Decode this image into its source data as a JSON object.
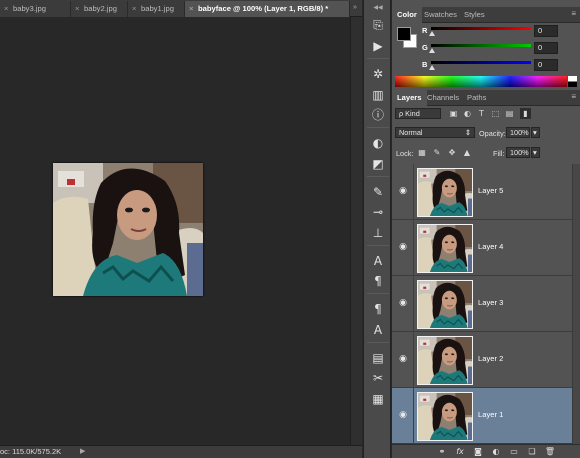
{
  "document_tabs": [
    {
      "close": "×",
      "label": "baby3.jpg",
      "active": false
    },
    {
      "close": "×",
      "label": "baby2.jpg",
      "active": false
    },
    {
      "close": "×",
      "label": "baby1.jpg",
      "active": false
    },
    {
      "close": "×",
      "label": "babyface @ 100% (Layer 1, RGB/8) *",
      "active": true
    }
  ],
  "tab_collapse_glyph": "»",
  "status": {
    "doc_size": "oc: 115.0K/575.2K",
    "arrow": "▶"
  },
  "dock": {
    "collapse_glyph": "◀◀",
    "icons": [
      "history-icon",
      "actions-icon",
      "navigator-icon",
      "histogram-icon",
      "info-icon",
      "adjustments-icon",
      "styles-icon",
      "brush-icon",
      "brush-presets-icon",
      "clone-source-icon",
      "character-icon",
      "paragraph-icon",
      "character-styles-icon",
      "paragraph-styles-icon",
      "layer-comps-icon",
      "tool-presets-icon",
      "notes-icon"
    ]
  },
  "color_panel": {
    "tabs": [
      "Color",
      "Swatches",
      "Styles"
    ],
    "channels": [
      {
        "label": "R",
        "value": "0",
        "color": "#ff0000"
      },
      {
        "label": "G",
        "value": "0",
        "color": "#00cc00"
      },
      {
        "label": "B",
        "value": "0",
        "color": "#0000ff"
      }
    ],
    "foreground": "#000000",
    "background": "#ffffff",
    "menu_glyph": "≡"
  },
  "layers_panel": {
    "tabs": [
      "Layers",
      "Channels",
      "Paths"
    ],
    "menu_glyph": "≡",
    "filter_kind": "ρ Kind",
    "blend_mode": "Normal",
    "opacity_label": "Opacity:",
    "opacity_value": "100%",
    "lock_label": "Lock:",
    "fill_label": "Fill:",
    "fill_value": "100%",
    "layers": [
      {
        "name": "Layer 5",
        "selected": false
      },
      {
        "name": "Layer 4",
        "selected": false
      },
      {
        "name": "Layer 3",
        "selected": false
      },
      {
        "name": "Layer 2",
        "selected": false
      },
      {
        "name": "Layer 1",
        "selected": true
      }
    ],
    "selected_color": "#6a7f98"
  }
}
